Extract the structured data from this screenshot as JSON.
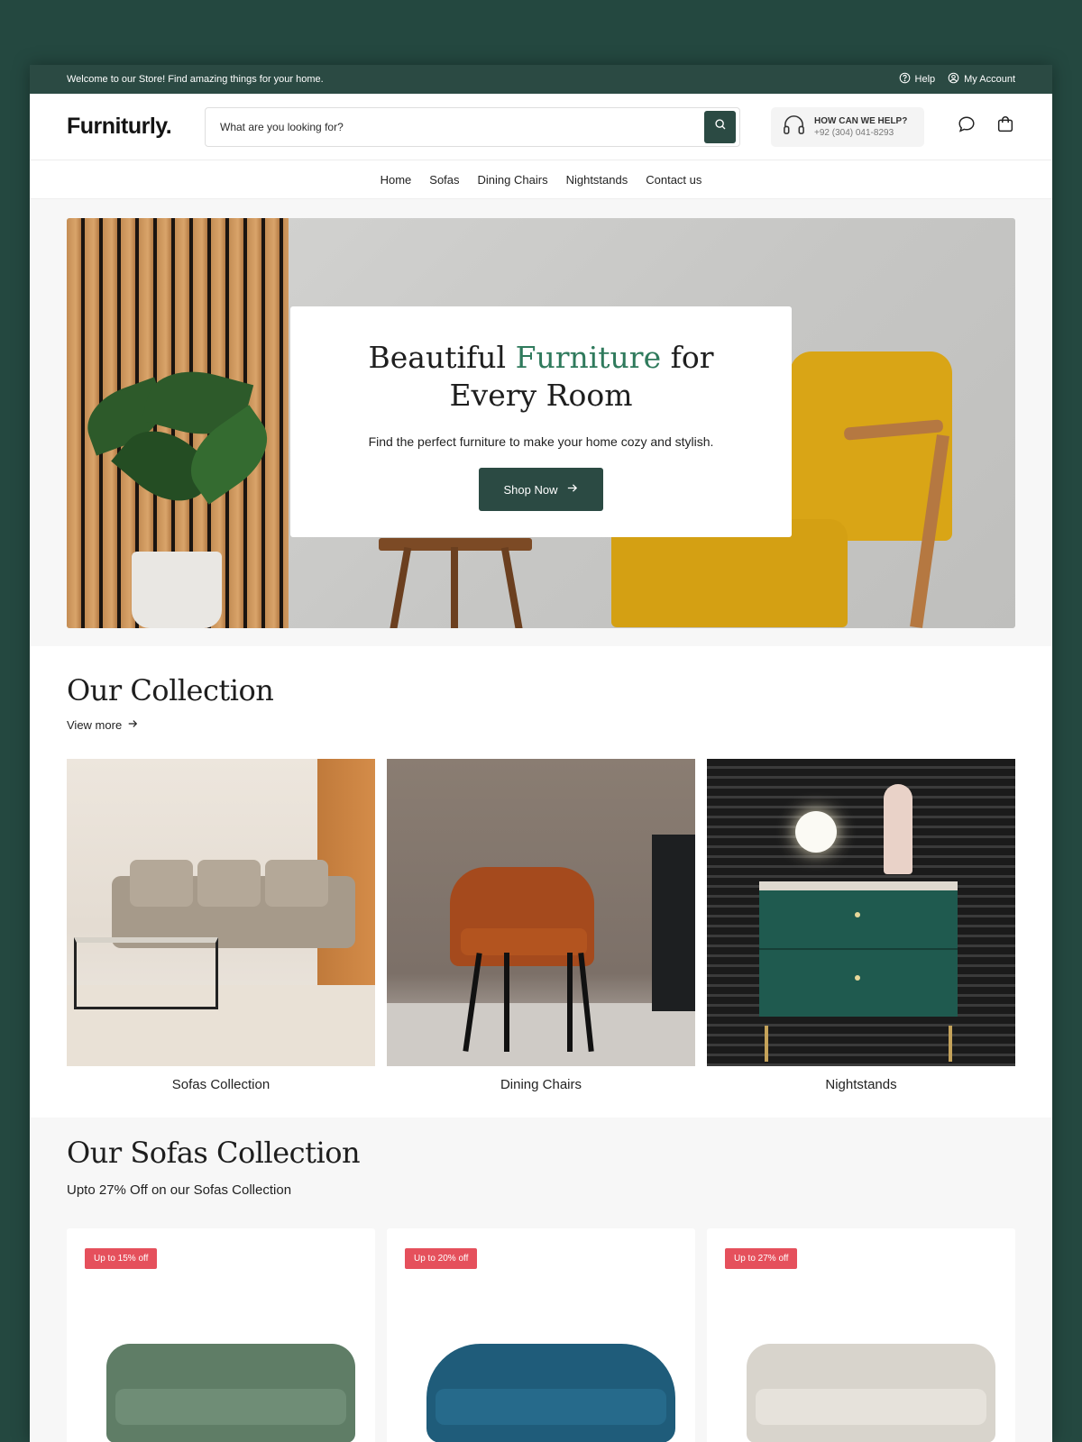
{
  "topbar": {
    "welcome": "Welcome to our Store! Find amazing things for your home.",
    "help": "Help",
    "account": "My Account"
  },
  "header": {
    "logo": "Furniturly.",
    "search_placeholder": "What are you looking for?",
    "help_title": "HOW CAN WE HELP?",
    "help_phone": "+92 (304) 041-8293"
  },
  "nav": {
    "items": [
      {
        "label": "Home"
      },
      {
        "label": "Sofas"
      },
      {
        "label": "Dining Chairs"
      },
      {
        "label": "Nightstands"
      },
      {
        "label": "Contact us"
      }
    ]
  },
  "hero": {
    "title_before": "Beautiful ",
    "title_accent": "Furniture",
    "title_after": " for Every Room",
    "subtitle": "Find the perfect furniture to make your home cozy and stylish.",
    "cta": "Shop Now"
  },
  "collection": {
    "title": "Our Collection",
    "view_more": "View more",
    "cards": [
      {
        "label": "Sofas Collection"
      },
      {
        "label": "Dining Chairs"
      },
      {
        "label": "Nightstands"
      }
    ]
  },
  "sofas": {
    "title": "Our Sofas Collection",
    "subtitle": "Upto 27% Off on our Sofas Collection",
    "products": [
      {
        "badge": "Up to 15% off",
        "color": "#5f7d66"
      },
      {
        "badge": "Up to 20% off",
        "color": "#1f5c7a"
      },
      {
        "badge": "Up to 27% off",
        "color": "#d8d4cc"
      }
    ]
  },
  "colors": {
    "brand": "#2b4a43",
    "accent": "#2f7a5c",
    "badge": "#e5505c",
    "background": "#244840"
  }
}
